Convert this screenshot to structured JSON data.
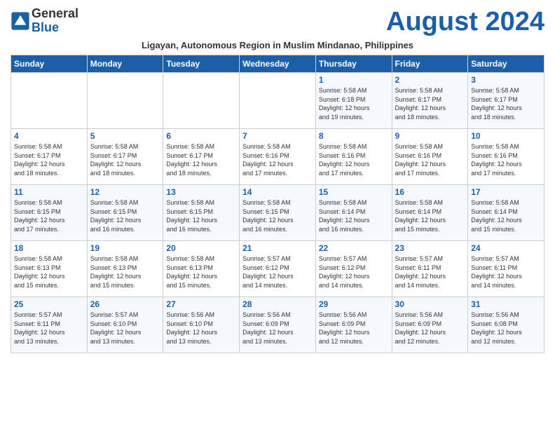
{
  "header": {
    "logo_line1": "General",
    "logo_line2": "Blue",
    "month_title": "August 2024",
    "subtitle": "Ligayan, Autonomous Region in Muslim Mindanao, Philippines"
  },
  "days_of_week": [
    "Sunday",
    "Monday",
    "Tuesday",
    "Wednesday",
    "Thursday",
    "Friday",
    "Saturday"
  ],
  "weeks": [
    [
      {
        "day": "",
        "info": ""
      },
      {
        "day": "",
        "info": ""
      },
      {
        "day": "",
        "info": ""
      },
      {
        "day": "",
        "info": ""
      },
      {
        "day": "1",
        "info": "Sunrise: 5:58 AM\nSunset: 6:18 PM\nDaylight: 12 hours\nand 19 minutes."
      },
      {
        "day": "2",
        "info": "Sunrise: 5:58 AM\nSunset: 6:17 PM\nDaylight: 12 hours\nand 18 minutes."
      },
      {
        "day": "3",
        "info": "Sunrise: 5:58 AM\nSunset: 6:17 PM\nDaylight: 12 hours\nand 18 minutes."
      }
    ],
    [
      {
        "day": "4",
        "info": "Sunrise: 5:58 AM\nSunset: 6:17 PM\nDaylight: 12 hours\nand 18 minutes."
      },
      {
        "day": "5",
        "info": "Sunrise: 5:58 AM\nSunset: 6:17 PM\nDaylight: 12 hours\nand 18 minutes."
      },
      {
        "day": "6",
        "info": "Sunrise: 5:58 AM\nSunset: 6:17 PM\nDaylight: 12 hours\nand 18 minutes."
      },
      {
        "day": "7",
        "info": "Sunrise: 5:58 AM\nSunset: 6:16 PM\nDaylight: 12 hours\nand 17 minutes."
      },
      {
        "day": "8",
        "info": "Sunrise: 5:58 AM\nSunset: 6:16 PM\nDaylight: 12 hours\nand 17 minutes."
      },
      {
        "day": "9",
        "info": "Sunrise: 5:58 AM\nSunset: 6:16 PM\nDaylight: 12 hours\nand 17 minutes."
      },
      {
        "day": "10",
        "info": "Sunrise: 5:58 AM\nSunset: 6:16 PM\nDaylight: 12 hours\nand 17 minutes."
      }
    ],
    [
      {
        "day": "11",
        "info": "Sunrise: 5:58 AM\nSunset: 6:15 PM\nDaylight: 12 hours\nand 17 minutes."
      },
      {
        "day": "12",
        "info": "Sunrise: 5:58 AM\nSunset: 6:15 PM\nDaylight: 12 hours\nand 16 minutes."
      },
      {
        "day": "13",
        "info": "Sunrise: 5:58 AM\nSunset: 6:15 PM\nDaylight: 12 hours\nand 16 minutes."
      },
      {
        "day": "14",
        "info": "Sunrise: 5:58 AM\nSunset: 6:15 PM\nDaylight: 12 hours\nand 16 minutes."
      },
      {
        "day": "15",
        "info": "Sunrise: 5:58 AM\nSunset: 6:14 PM\nDaylight: 12 hours\nand 16 minutes."
      },
      {
        "day": "16",
        "info": "Sunrise: 5:58 AM\nSunset: 6:14 PM\nDaylight: 12 hours\nand 15 minutes."
      },
      {
        "day": "17",
        "info": "Sunrise: 5:58 AM\nSunset: 6:14 PM\nDaylight: 12 hours\nand 15 minutes."
      }
    ],
    [
      {
        "day": "18",
        "info": "Sunrise: 5:58 AM\nSunset: 6:13 PM\nDaylight: 12 hours\nand 15 minutes."
      },
      {
        "day": "19",
        "info": "Sunrise: 5:58 AM\nSunset: 6:13 PM\nDaylight: 12 hours\nand 15 minutes."
      },
      {
        "day": "20",
        "info": "Sunrise: 5:58 AM\nSunset: 6:13 PM\nDaylight: 12 hours\nand 15 minutes."
      },
      {
        "day": "21",
        "info": "Sunrise: 5:57 AM\nSunset: 6:12 PM\nDaylight: 12 hours\nand 14 minutes."
      },
      {
        "day": "22",
        "info": "Sunrise: 5:57 AM\nSunset: 6:12 PM\nDaylight: 12 hours\nand 14 minutes."
      },
      {
        "day": "23",
        "info": "Sunrise: 5:57 AM\nSunset: 6:11 PM\nDaylight: 12 hours\nand 14 minutes."
      },
      {
        "day": "24",
        "info": "Sunrise: 5:57 AM\nSunset: 6:11 PM\nDaylight: 12 hours\nand 14 minutes."
      }
    ],
    [
      {
        "day": "25",
        "info": "Sunrise: 5:57 AM\nSunset: 6:11 PM\nDaylight: 12 hours\nand 13 minutes."
      },
      {
        "day": "26",
        "info": "Sunrise: 5:57 AM\nSunset: 6:10 PM\nDaylight: 12 hours\nand 13 minutes."
      },
      {
        "day": "27",
        "info": "Sunrise: 5:56 AM\nSunset: 6:10 PM\nDaylight: 12 hours\nand 13 minutes."
      },
      {
        "day": "28",
        "info": "Sunrise: 5:56 AM\nSunset: 6:09 PM\nDaylight: 12 hours\nand 13 minutes."
      },
      {
        "day": "29",
        "info": "Sunrise: 5:56 AM\nSunset: 6:09 PM\nDaylight: 12 hours\nand 12 minutes."
      },
      {
        "day": "30",
        "info": "Sunrise: 5:56 AM\nSunset: 6:09 PM\nDaylight: 12 hours\nand 12 minutes."
      },
      {
        "day": "31",
        "info": "Sunrise: 5:56 AM\nSunset: 6:08 PM\nDaylight: 12 hours\nand 12 minutes."
      }
    ]
  ]
}
